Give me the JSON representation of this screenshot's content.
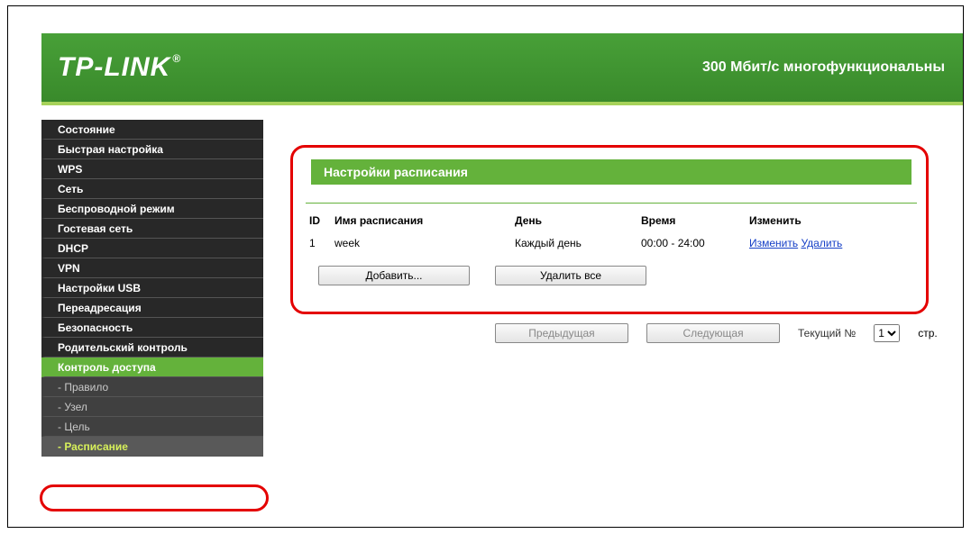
{
  "header": {
    "brand": "TP-LINK",
    "reg": "®",
    "title": "300 Мбит/с многофункциональны"
  },
  "sidebar": {
    "items": [
      {
        "label": "Состояние",
        "type": "top"
      },
      {
        "label": "Быстрая настройка",
        "type": "top"
      },
      {
        "label": "WPS",
        "type": "top"
      },
      {
        "label": "Сеть",
        "type": "top"
      },
      {
        "label": "Беспроводной режим",
        "type": "top"
      },
      {
        "label": "Гостевая сеть",
        "type": "top"
      },
      {
        "label": "DHCP",
        "type": "top"
      },
      {
        "label": "VPN",
        "type": "top"
      },
      {
        "label": "Настройки USB",
        "type": "top"
      },
      {
        "label": "Переадресация",
        "type": "top"
      },
      {
        "label": "Безопасность",
        "type": "top"
      },
      {
        "label": "Родительский контроль",
        "type": "top"
      },
      {
        "label": "Контроль доступа",
        "type": "active-parent"
      },
      {
        "label": "- Правило",
        "type": "sub"
      },
      {
        "label": "- Узел",
        "type": "sub"
      },
      {
        "label": "- Цель",
        "type": "sub"
      },
      {
        "label": "- Расписание",
        "type": "sub selected"
      }
    ]
  },
  "panel": {
    "title": "Настройки расписания",
    "columns": {
      "id": "ID",
      "name": "Имя расписания",
      "day": "День",
      "time": "Время",
      "modify": "Изменить"
    },
    "rows": [
      {
        "id": "1",
        "name": "week",
        "day": "Каждый день",
        "time": "00:00 - 24:00",
        "edit": "Изменить",
        "del": "Удалить"
      }
    ],
    "buttons": {
      "add": "Добавить...",
      "delete_all": "Удалить все"
    }
  },
  "pager": {
    "prev": "Предыдущая",
    "next": "Следующая",
    "current_label": "Текущий №",
    "page": "1",
    "suffix": "стр."
  }
}
